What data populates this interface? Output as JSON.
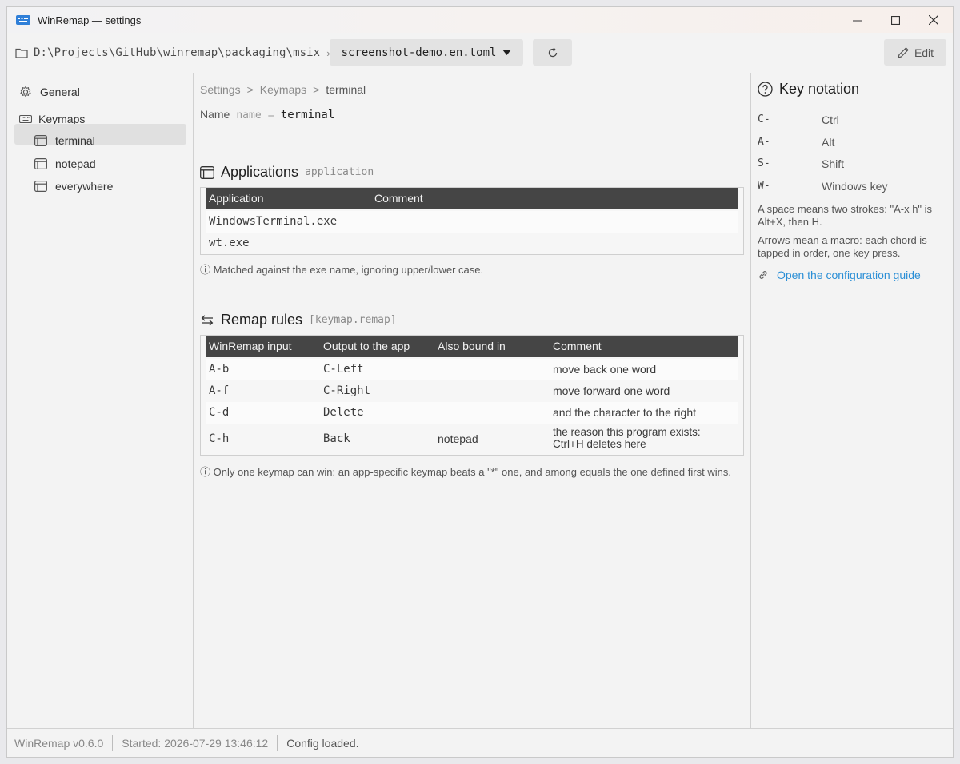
{
  "window": {
    "title": "WinRemap — settings",
    "accent_color": "#2f7fd8"
  },
  "toolbar": {
    "path": "D:\\Projects\\GitHub\\winremap\\packaging\\msix",
    "path_separator": "›",
    "file_selector": "screenshot-demo.en.toml",
    "edit_label": "Edit"
  },
  "sidebar": {
    "general_label": "General",
    "keymaps_label": "Keymaps",
    "keymaps": [
      {
        "label": "terminal",
        "selected": true
      },
      {
        "label": "notepad",
        "selected": false
      },
      {
        "label": "everywhere",
        "selected": false
      }
    ]
  },
  "main": {
    "breadcrumb": [
      "Settings",
      ">",
      "Keymaps",
      ">",
      "terminal"
    ],
    "name_label": "Name",
    "name_key": "name",
    "name_eq": "=",
    "name_value": "terminal",
    "applications": {
      "title": "Applications",
      "key": "application",
      "headers": [
        "Application",
        "Comment"
      ],
      "rows": [
        {
          "app": "WindowsTerminal.exe",
          "comment": ""
        },
        {
          "app": "wt.exe",
          "comment": ""
        }
      ],
      "note": "ⓘ Matched against the exe name, ignoring upper/lower case."
    },
    "remap": {
      "title": "Remap rules",
      "key": "[keymap.remap]",
      "headers": [
        "WinRemap input",
        "Output to the app",
        "Also bound in",
        "Comment"
      ],
      "rows": [
        {
          "input": "A-b",
          "output": "C-Left",
          "also": "",
          "comment": "move back one word"
        },
        {
          "input": "A-f",
          "output": "C-Right",
          "also": "",
          "comment": "move forward one word"
        },
        {
          "input": "C-d",
          "output": "Delete",
          "also": "",
          "comment": "and the character to the right"
        },
        {
          "input": "C-h",
          "output": "Back",
          "also": "notepad",
          "comment": "the reason this program exists: Ctrl+H deletes here"
        }
      ],
      "note": "ⓘ Only one keymap can win: an app-specific keymap beats a \"*\" one, and among equals the one defined first wins."
    }
  },
  "key_notation": {
    "title": "Key notation",
    "rows": [
      {
        "key": "C-",
        "value": "Ctrl"
      },
      {
        "key": "A-",
        "value": "Alt"
      },
      {
        "key": "S-",
        "value": "Shift"
      },
      {
        "key": "W-",
        "value": "Windows key"
      }
    ],
    "note1": "A space means two strokes: \"A-x h\" is Alt+X, then H.",
    "note2": "Arrows mean a macro: each chord is tapped in order, one key press.",
    "link": "Open the configuration guide",
    "link_color": "#2b8fd6"
  },
  "status": {
    "version": "WinRemap v0.6.0",
    "started": "Started: 2026-07-29 13:46:12",
    "message": "Config loaded."
  }
}
